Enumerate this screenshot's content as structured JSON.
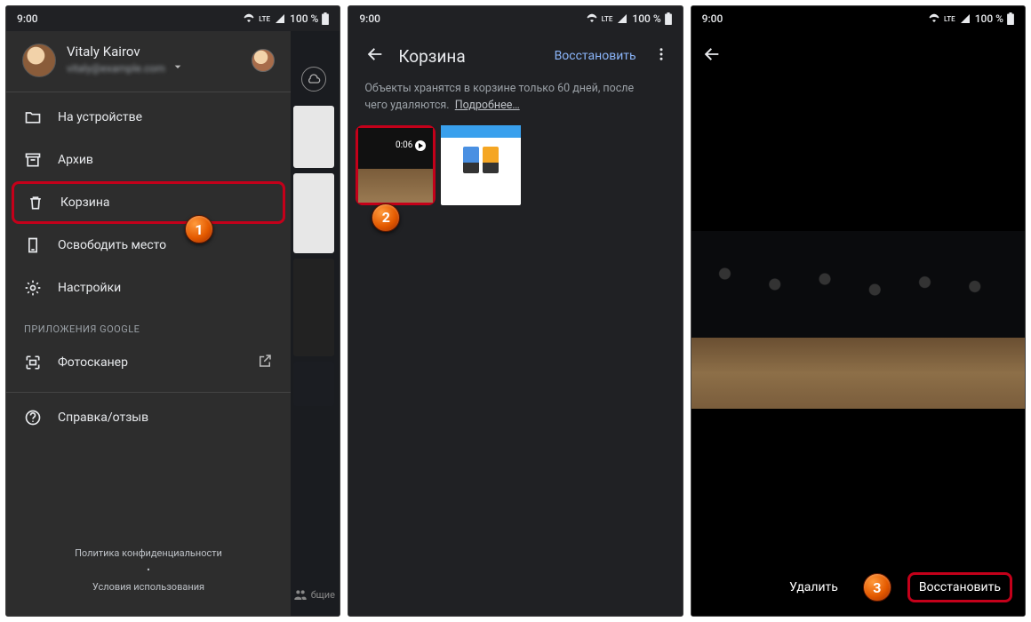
{
  "status": {
    "time": "9:00",
    "net": "LTE",
    "battery": "100 %"
  },
  "screen1": {
    "user": {
      "name": "Vitaly Kairov",
      "email": "vitaly@example.com"
    },
    "items": {
      "device": "На устройстве",
      "archive": "Архив",
      "trash": "Корзина",
      "free_space": "Освободить место",
      "settings": "Настройки"
    },
    "section_google": "ПРИЛОЖЕНИЯ GOOGLE",
    "photoscan": "Фотосканер",
    "help": "Справка/отзыв",
    "footer": {
      "privacy": "Политика конфиденциальности",
      "terms": "Условия использования"
    },
    "bg_tab": "бщие"
  },
  "screen2": {
    "title": "Корзина",
    "restore": "Восстановить",
    "info_line1": "Объекты хранятся в корзине только 60 дней, после",
    "info_line2": "чего удаляются.",
    "more_link": "Подробнее…",
    "video_duration": "0:06"
  },
  "screen3": {
    "delete": "Удалить",
    "restore": "Восстановить"
  },
  "callouts": {
    "c1": "1",
    "c2": "2",
    "c3": "3"
  }
}
